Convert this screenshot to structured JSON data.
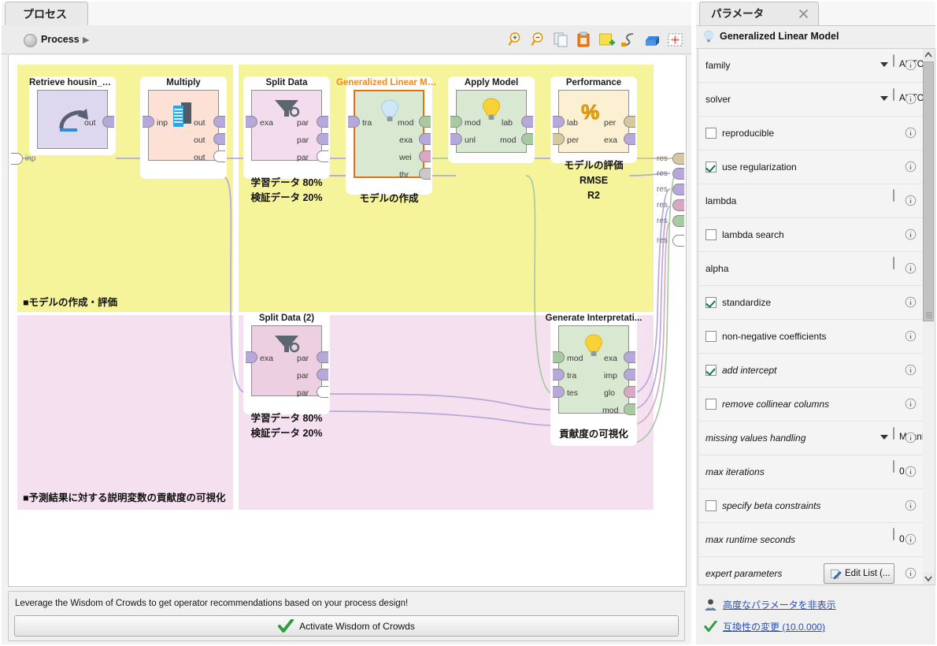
{
  "process_panel": {
    "tab_label": "プロセス",
    "breadcrumb": {
      "label": "Process",
      "arrow": "▶"
    },
    "canvas_watermark": "Process",
    "toolbar": [
      {
        "name": "zoom-in-icon",
        "title": "Zoom In"
      },
      {
        "name": "zoom-out-icon",
        "title": "Zoom Out"
      },
      {
        "name": "copy-icon",
        "title": "Copy"
      },
      {
        "name": "paste-icon",
        "title": "Paste"
      },
      {
        "name": "add-note-icon",
        "title": "Add Note"
      },
      {
        "name": "auto-wire-icon",
        "title": "Auto Wire"
      },
      {
        "name": "arrange-icon",
        "title": "Arrange"
      },
      {
        "name": "fit-to-screen-icon",
        "title": "Fit Process to Screen"
      }
    ]
  },
  "canvas": {
    "input_port_label": "inp",
    "result_port_label": "res",
    "result_port_count": 6,
    "regions": [
      {
        "name": "model-build-evaluate",
        "label": "■モデルの作成・評価",
        "color": "#f6f49a"
      },
      {
        "name": "contribution-visualization",
        "label": "■予測結果に対する説明変数の貢献度の可視化",
        "color": "#f4e0ee"
      }
    ],
    "operators": [
      {
        "id": "retrieve-housing-data",
        "title": "Retrieve housin_data",
        "icon": "retrieve-icon",
        "fill": "#ddd8ef",
        "selected": false,
        "inputs": [],
        "outputs": [
          {
            "label": "out",
            "color": "#b6a8dd"
          }
        ],
        "note": ""
      },
      {
        "id": "multiply",
        "title": "Multiply",
        "icon": "multiply-icon",
        "fill": "#fce1d4",
        "selected": false,
        "inputs": [
          {
            "label": "inp",
            "color": "#b6a8dd"
          }
        ],
        "outputs": [
          {
            "label": "out",
            "color": "#b6a8dd"
          },
          {
            "label": "out",
            "color": "#b6a8dd"
          },
          {
            "label": "out",
            "color": "#ffffff"
          }
        ],
        "note": ""
      },
      {
        "id": "split-data",
        "title": "Split Data",
        "icon": "filter-icon",
        "fill": "#f3dced",
        "selected": false,
        "inputs": [
          {
            "label": "exa",
            "color": "#b6a8dd"
          }
        ],
        "outputs": [
          {
            "label": "par",
            "color": "#b6a8dd"
          },
          {
            "label": "par",
            "color": "#b6a8dd"
          },
          {
            "label": "par",
            "color": "#ffffff"
          }
        ],
        "note": "学習データ 80%\n検証データ 20%"
      },
      {
        "id": "generalized-linear-model",
        "title": "Generalized Linear Model",
        "icon": "bulb-icon",
        "fill": "#d8e8d1",
        "selected": true,
        "inputs": [
          {
            "label": "tra",
            "color": "#b6a8dd"
          }
        ],
        "outputs": [
          {
            "label": "mod",
            "color": "#a8caa0"
          },
          {
            "label": "exa",
            "color": "#b6a8dd"
          },
          {
            "label": "wei",
            "color": "#dba8c4"
          },
          {
            "label": "thr",
            "color": "#c9c9c9"
          }
        ],
        "note": "モデルの作成"
      },
      {
        "id": "apply-model",
        "title": "Apply Model",
        "icon": "bulb-icon",
        "fill": "#d8e8d1",
        "selected": false,
        "inputs": [
          {
            "label": "mod",
            "color": "#a8caa0"
          },
          {
            "label": "unl",
            "color": "#b6a8dd"
          }
        ],
        "outputs": [
          {
            "label": "lab",
            "color": "#b6a8dd"
          },
          {
            "label": "mod",
            "color": "#a8caa0"
          }
        ],
        "note": ""
      },
      {
        "id": "performance",
        "title": "Performance",
        "icon": "percent-icon",
        "fill": "#fbf0d2",
        "selected": false,
        "inputs": [
          {
            "label": "lab",
            "color": "#b6a8dd"
          },
          {
            "label": "per",
            "color": "#d6c9a0"
          }
        ],
        "outputs": [
          {
            "label": "per",
            "color": "#d6c9a0"
          },
          {
            "label": "exa",
            "color": "#b6a8dd"
          }
        ],
        "note": "モデルの評価\nRMSE\nR2"
      },
      {
        "id": "split-data-2",
        "title": "Split Data (2)",
        "icon": "filter-icon",
        "fill": "#eccfe0",
        "selected": false,
        "inputs": [
          {
            "label": "exa",
            "color": "#b6a8dd"
          }
        ],
        "outputs": [
          {
            "label": "par",
            "color": "#b6a8dd"
          },
          {
            "label": "par",
            "color": "#b6a8dd"
          },
          {
            "label": "par",
            "color": "#ffffff"
          }
        ],
        "note": "学習データ 80%\n検証データ 20%"
      },
      {
        "id": "generate-interpretation",
        "title": "Generate Interpretati...",
        "icon": "bulb-icon",
        "fill": "#d8e8d1",
        "selected": false,
        "inputs": [
          {
            "label": "mod",
            "color": "#a8caa0"
          },
          {
            "label": "tra",
            "color": "#b6a8dd"
          },
          {
            "label": "tes",
            "color": "#b6a8dd"
          }
        ],
        "outputs": [
          {
            "label": "exa",
            "color": "#b6a8dd"
          },
          {
            "label": "imp",
            "color": "#b6a8dd"
          },
          {
            "label": "glo",
            "color": "#dba8c4"
          },
          {
            "label": "mod",
            "color": "#a8caa0"
          }
        ],
        "note": "貢献度の可視化"
      }
    ]
  },
  "wisdom": {
    "text": "Leverage the Wisdom of Crowds to get operator recommendations based on your process design!",
    "button_label": "Activate Wisdom of Crowds"
  },
  "parameters_panel": {
    "tab_label": "パラメータ",
    "operator_name": "Generalized Linear Model",
    "rows": [
      {
        "name": "family",
        "label": "family",
        "type": "select",
        "value": "AUTO",
        "advanced": false
      },
      {
        "name": "solver",
        "label": "solver",
        "type": "select",
        "value": "AUTO",
        "advanced": false
      },
      {
        "name": "reproducible",
        "label": "reproducible",
        "type": "checkbox",
        "checked": false,
        "advanced": false
      },
      {
        "name": "use-regularization",
        "label": "use regularization",
        "type": "checkbox",
        "checked": true,
        "advanced": false
      },
      {
        "name": "lambda",
        "label": "lambda",
        "type": "text",
        "value": "",
        "advanced": false
      },
      {
        "name": "lambda-search",
        "label": "lambda search",
        "type": "checkbox",
        "checked": false,
        "advanced": false
      },
      {
        "name": "alpha",
        "label": "alpha",
        "type": "text",
        "value": "",
        "advanced": false
      },
      {
        "name": "standardize",
        "label": "standardize",
        "type": "checkbox",
        "checked": true,
        "advanced": false
      },
      {
        "name": "non-negative-coefficients",
        "label": "non-negative coefficients",
        "type": "checkbox",
        "checked": false,
        "advanced": false
      },
      {
        "name": "add-intercept",
        "label": "add intercept",
        "type": "checkbox",
        "checked": true,
        "advanced": true
      },
      {
        "name": "remove-collinear-columns",
        "label": "remove collinear columns",
        "type": "checkbox",
        "checked": false,
        "advanced": true
      },
      {
        "name": "missing-values-handling",
        "label": "missing values handling",
        "type": "select",
        "value": "MeanImpu...",
        "advanced": true
      },
      {
        "name": "max-iterations",
        "label": "max iterations",
        "type": "text",
        "value": "0",
        "advanced": true
      },
      {
        "name": "specify-beta-constraints",
        "label": "specify beta constraints",
        "type": "checkbox",
        "checked": false,
        "advanced": true
      },
      {
        "name": "max-runtime-seconds",
        "label": "max runtime seconds",
        "type": "text",
        "value": "0",
        "advanced": true
      },
      {
        "name": "expert-parameters",
        "label": "expert parameters",
        "type": "button",
        "value": "Edit List (...",
        "advanced": true
      }
    ],
    "footer_links": [
      {
        "name": "hide-advanced-parameters-link",
        "label": "高度なパラメータを非表示",
        "icon": "expert-user-icon"
      },
      {
        "name": "change-compatibility-link",
        "label": "互換性の変更 (10.0.000)",
        "icon": "green-check-icon"
      }
    ]
  }
}
